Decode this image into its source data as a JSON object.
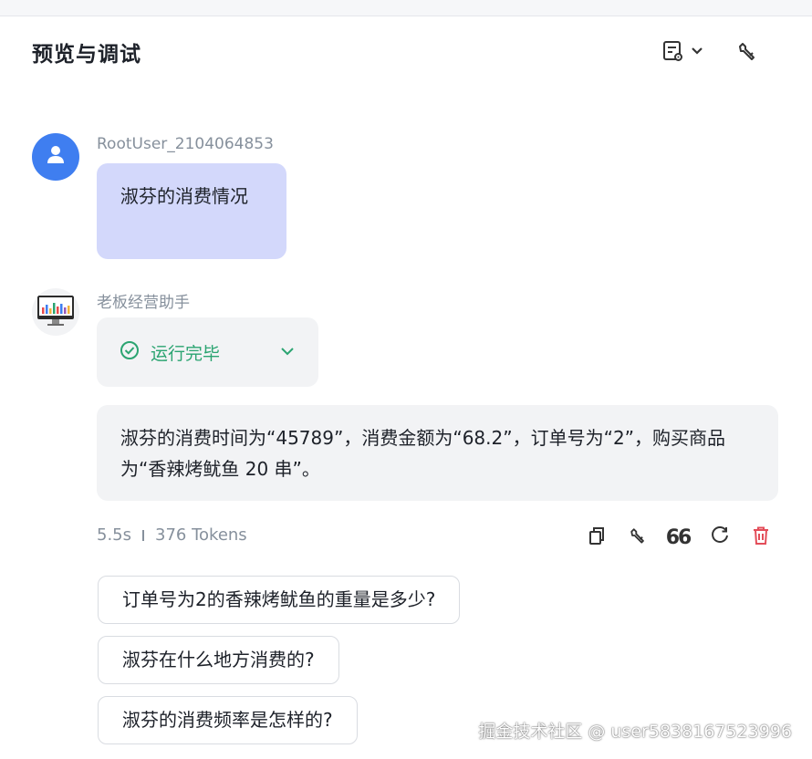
{
  "header": {
    "title": "预览与调试"
  },
  "user_message": {
    "username": "RootUser_2104064853",
    "text": "淑芬的消费情况"
  },
  "assistant": {
    "name": "老板经营助手",
    "status": "运行完毕",
    "answer": "淑芬的消费时间为“45789”，消费金额为“68.2”，订单号为“2”，购买商品为“香辣烤鱿鱼 20 串”。",
    "duration": "5.5s",
    "tokens": "376 Tokens",
    "actions": [
      "copy-icon",
      "wrench-icon",
      "quote-icon",
      "refresh-icon",
      "delete-icon"
    ]
  },
  "suggestions": [
    "订单号为2的香辣烤鱿鱼的重量是多少?",
    "淑芬在什么地方消费的?",
    "淑芬的消费频率是怎样的?"
  ],
  "watermark": "掘金技术社区 @ user5838167523996",
  "colors": {
    "user_bubble": "#d3d8fb",
    "avatar": "#3f7ef0",
    "status_green": "#2ba471",
    "delete_red": "#e34d59"
  }
}
